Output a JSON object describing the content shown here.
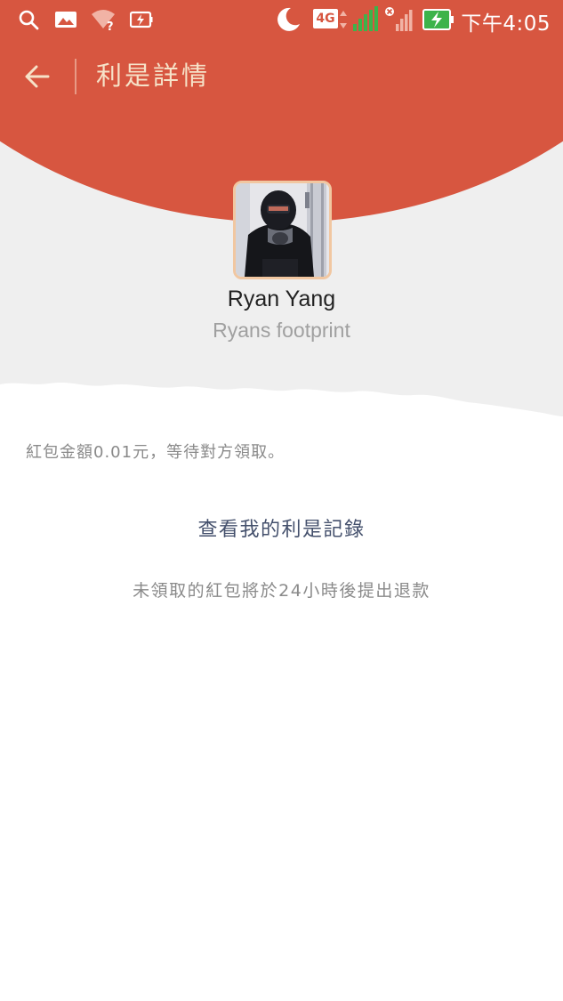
{
  "status_bar": {
    "network": "4G",
    "time": "下午4:05",
    "icons": [
      "search-icon",
      "image-icon",
      "wifi-unknown-icon",
      "charging-box-icon",
      "moon-icon",
      "signal-icon",
      "signal-no-sim-icon",
      "battery-charging-icon"
    ]
  },
  "header": {
    "title": "利是詳情",
    "back_icon": "arrow-left-icon",
    "color": "#d75640"
  },
  "sender": {
    "name": "Ryan Yang",
    "subtitle": "Ryans footprint"
  },
  "detail": {
    "amount_status": "紅包金額0.01元，等待對方領取。",
    "records_link": "查看我的利是記錄",
    "refund_note": "未領取的紅包將於24小時後提出退款"
  }
}
